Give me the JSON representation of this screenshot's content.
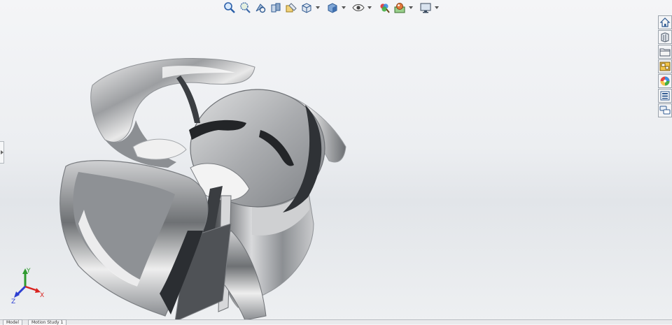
{
  "toolbar": {
    "buttons": [
      {
        "name": "zoom-to-fit-icon",
        "dropdown": false
      },
      {
        "name": "zoom-to-area-icon",
        "dropdown": false
      },
      {
        "name": "previous-view-icon",
        "dropdown": false
      },
      {
        "name": "section-view-icon",
        "dropdown": false
      },
      {
        "name": "dynamic-annotation-icon",
        "dropdown": false
      },
      {
        "name": "view-orientation-icon",
        "dropdown": true
      },
      {
        "name": "display-style-icon",
        "dropdown": true
      },
      {
        "name": "hide-show-items-icon",
        "dropdown": true
      },
      {
        "name": "edit-appearance-icon",
        "dropdown": false
      },
      {
        "name": "apply-scene-icon",
        "dropdown": true
      },
      {
        "name": "view-settings-icon",
        "dropdown": true
      }
    ]
  },
  "taskpane": {
    "buttons": [
      "home-icon",
      "design-library-icon",
      "file-explorer-icon",
      "view-palette-icon",
      "appearances-icon",
      "custom-properties-icon",
      "forum-icon"
    ]
  },
  "triad": {
    "x_label": "X",
    "y_label": "Y",
    "z_label": "Z"
  },
  "colors": {
    "x_axis": "#d9231f",
    "y_axis": "#2e9a2e",
    "z_axis": "#2d3fd2",
    "metal_dark": "#2a2c2f",
    "metal_light": "#f2f2f2"
  },
  "tabs": [
    {
      "label": "Model"
    },
    {
      "label": "Motion Study 1"
    }
  ]
}
